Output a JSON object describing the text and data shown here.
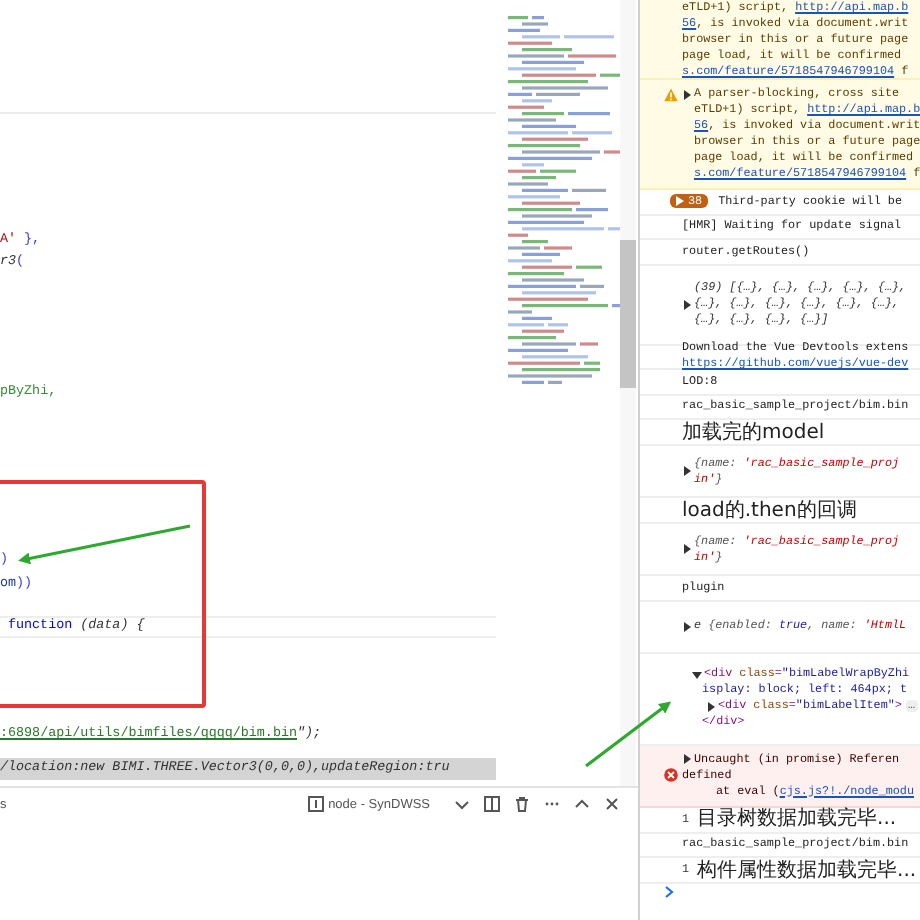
{
  "editor": {
    "code_lines": [
      {
        "current": false,
        "selected": false,
        "parts": [
          {
            "kind": "str",
            "text": "A'"
          },
          {
            "kind": "punc",
            "text": " },"
          }
        ]
      },
      {
        "current": false,
        "selected": false,
        "parts": [
          {
            "kind": "plain",
            "text": "r3"
          },
          {
            "kind": "punc",
            "text": "("
          }
        ]
      },
      {
        "current": false,
        "selected": false,
        "parts": [
          {
            "kind": "ident",
            "text": "pByZhi,"
          }
        ]
      },
      {
        "current": false,
        "selected": false,
        "parts": [
          {
            "kind": "punc",
            "text": ")"
          }
        ]
      },
      {
        "current": false,
        "selected": false,
        "parts": [
          {
            "kind": "var",
            "text": "om"
          },
          {
            "kind": "punc",
            "text": "))"
          }
        ]
      },
      {
        "current": true,
        "selected": false,
        "parts": [
          {
            "kind": "kw",
            "text": "function"
          },
          {
            "kind": "plain",
            "text": " (data) {"
          }
        ]
      },
      {
        "current": false,
        "selected": false,
        "parts": [
          {
            "kind": "link",
            "text": ":6898/api/utils/bimfiles/qqqq/bim.bin"
          },
          {
            "kind": "plain",
            "text": "\");"
          }
        ]
      },
      {
        "current": false,
        "selected": true,
        "parts": [
          {
            "kind": "plain",
            "text": "/location:new BIMI.THREE.Vector3(0,0,0),updateRegion:tru"
          }
        ]
      }
    ]
  },
  "terminal": {
    "tab_label": "s",
    "process": "node - SynDWSS"
  },
  "console": {
    "entries": [
      {
        "kind": "continuation",
        "lines": [
          [
            {
              "kind": "text",
              "text": "eTLD+1) script, "
            },
            {
              "kind": "link",
              "text": "http://api.map.b"
            }
          ],
          [
            {
              "kind": "link",
              "text": "56"
            },
            {
              "kind": "text",
              "text": ", is invoked via document.writ"
            }
          ],
          [
            {
              "kind": "text",
              "text": "browser in this or a future page"
            }
          ],
          [
            {
              "kind": "text",
              "text": "page load, it will be confirmed"
            }
          ],
          [
            {
              "kind": "link",
              "text": "s.com/feature/5718547946799104"
            },
            {
              "kind": "text",
              "text": " f"
            }
          ]
        ]
      },
      {
        "kind": "warning",
        "expanded": false,
        "lines": [
          [
            {
              "kind": "text",
              "text": "A parser-blocking, cross site"
            }
          ],
          [
            {
              "kind": "text",
              "text": "eTLD+1) script, "
            },
            {
              "kind": "link",
              "text": "http://api.map.b"
            }
          ],
          [
            {
              "kind": "link",
              "text": "56"
            },
            {
              "kind": "text",
              "text": ", is invoked via document.writ"
            }
          ],
          [
            {
              "kind": "text",
              "text": "browser in this or a future page"
            }
          ],
          [
            {
              "kind": "text",
              "text": "page load, it will be confirmed"
            }
          ],
          [
            {
              "kind": "link",
              "text": "s.com/feature/5718547946799104"
            },
            {
              "kind": "text",
              "text": " f"
            }
          ]
        ]
      },
      {
        "kind": "issues",
        "count": "38",
        "text": "Third-party cookie will be"
      },
      {
        "kind": "log",
        "text": "[HMR] Waiting for update signal"
      },
      {
        "kind": "log",
        "text": "router.getRoutes()"
      },
      {
        "kind": "object",
        "expanded": false,
        "lines": [
          [
            {
              "kind": "preview",
              "text": "(39) [{…}, {…}, {…}, {…}, {…},"
            }
          ],
          [
            {
              "kind": "preview",
              "text": "{…}, {…}, {…}, {…}, {…}, {…},"
            }
          ],
          [
            {
              "kind": "preview",
              "text": "{…}, {…}, {…}, {…}]"
            }
          ]
        ]
      },
      {
        "kind": "log",
        "text": "Download the Vue Devtools extens",
        "link": "https://github.com/vuejs/vue-dev"
      },
      {
        "kind": "log",
        "text": "LOD:8"
      },
      {
        "kind": "log",
        "text": "rac_basic_sample_project/bim.bin"
      },
      {
        "kind": "cjk",
        "text": "加载完的model"
      },
      {
        "kind": "object",
        "expanded": false,
        "lines": [
          [
            {
              "kind": "key",
              "text": "{name: "
            },
            {
              "kind": "string",
              "text": "'rac_basic_sample_proj"
            }
          ],
          [
            {
              "kind": "string",
              "text": "in'"
            },
            {
              "kind": "key",
              "text": "}"
            }
          ]
        ]
      },
      {
        "kind": "cjk",
        "text": "load的.then的回调"
      },
      {
        "kind": "object",
        "expanded": false,
        "lines": [
          [
            {
              "kind": "key",
              "text": "{name: "
            },
            {
              "kind": "string",
              "text": "'rac_basic_sample_proj"
            }
          ],
          [
            {
              "kind": "string",
              "text": "in'"
            },
            {
              "kind": "key",
              "text": "}"
            }
          ]
        ]
      },
      {
        "kind": "log",
        "text": "plugin"
      },
      {
        "kind": "object",
        "expanded": false,
        "lines": [
          [
            {
              "kind": "plain",
              "text": "e "
            },
            {
              "kind": "key",
              "text": "{enabled: "
            },
            {
              "kind": "bool",
              "text": "true"
            },
            {
              "kind": "key",
              "text": ", name: "
            },
            {
              "kind": "string",
              "text": "'HtmlL"
            }
          ]
        ]
      },
      {
        "kind": "element",
        "expanded": true,
        "lines": [
          {
            "kind": "open",
            "parts": [
              {
                "kind": "tag",
                "text": "<div"
              },
              {
                "kind": "attr",
                "text": " class"
              },
              {
                "kind": "punc",
                "text": "="
              },
              {
                "kind": "value",
                "text": "\"bimLabelWrapByZhi"
              }
            ]
          },
          {
            "kind": "attrs",
            "parts": [
              {
                "kind": "value",
                "text": "isplay: block; left: 464px; t"
              }
            ]
          },
          {
            "kind": "child",
            "expanded": false,
            "parts": [
              {
                "kind": "tag",
                "text": "<div"
              },
              {
                "kind": "attr",
                "text": " class"
              },
              {
                "kind": "punc",
                "text": "="
              },
              {
                "kind": "value",
                "text": "\"bimLabelItem\""
              },
              {
                "kind": "tag",
                "text": ">"
              },
              {
                "kind": "ellipsis",
                "text": "…"
              }
            ]
          },
          {
            "kind": "close",
            "parts": [
              {
                "kind": "tag",
                "text": "</div>"
              }
            ]
          }
        ]
      },
      {
        "kind": "error",
        "expanded": false,
        "lines": [
          {
            "kind": "message",
            "parts": [
              {
                "kind": "text",
                "text": "Uncaught (in promise) Referen"
              }
            ]
          },
          {
            "kind": "message",
            "parts": [
              {
                "kind": "text",
                "text": "defined"
              }
            ]
          },
          {
            "kind": "stack",
            "parts": [
              {
                "kind": "text",
                "text": "at eval ("
              },
              {
                "kind": "link",
                "text": "cjs.js?!./node_modu"
              }
            ]
          }
        ]
      },
      {
        "kind": "cjk",
        "count": "1",
        "text": "目录树数据加载完毕..."
      },
      {
        "kind": "log",
        "text": "rac_basic_sample_project/bim.bin"
      },
      {
        "kind": "cjk",
        "count": "1",
        "text": "构件属性数据加载完毕..."
      },
      {
        "kind": "prompt"
      }
    ]
  }
}
